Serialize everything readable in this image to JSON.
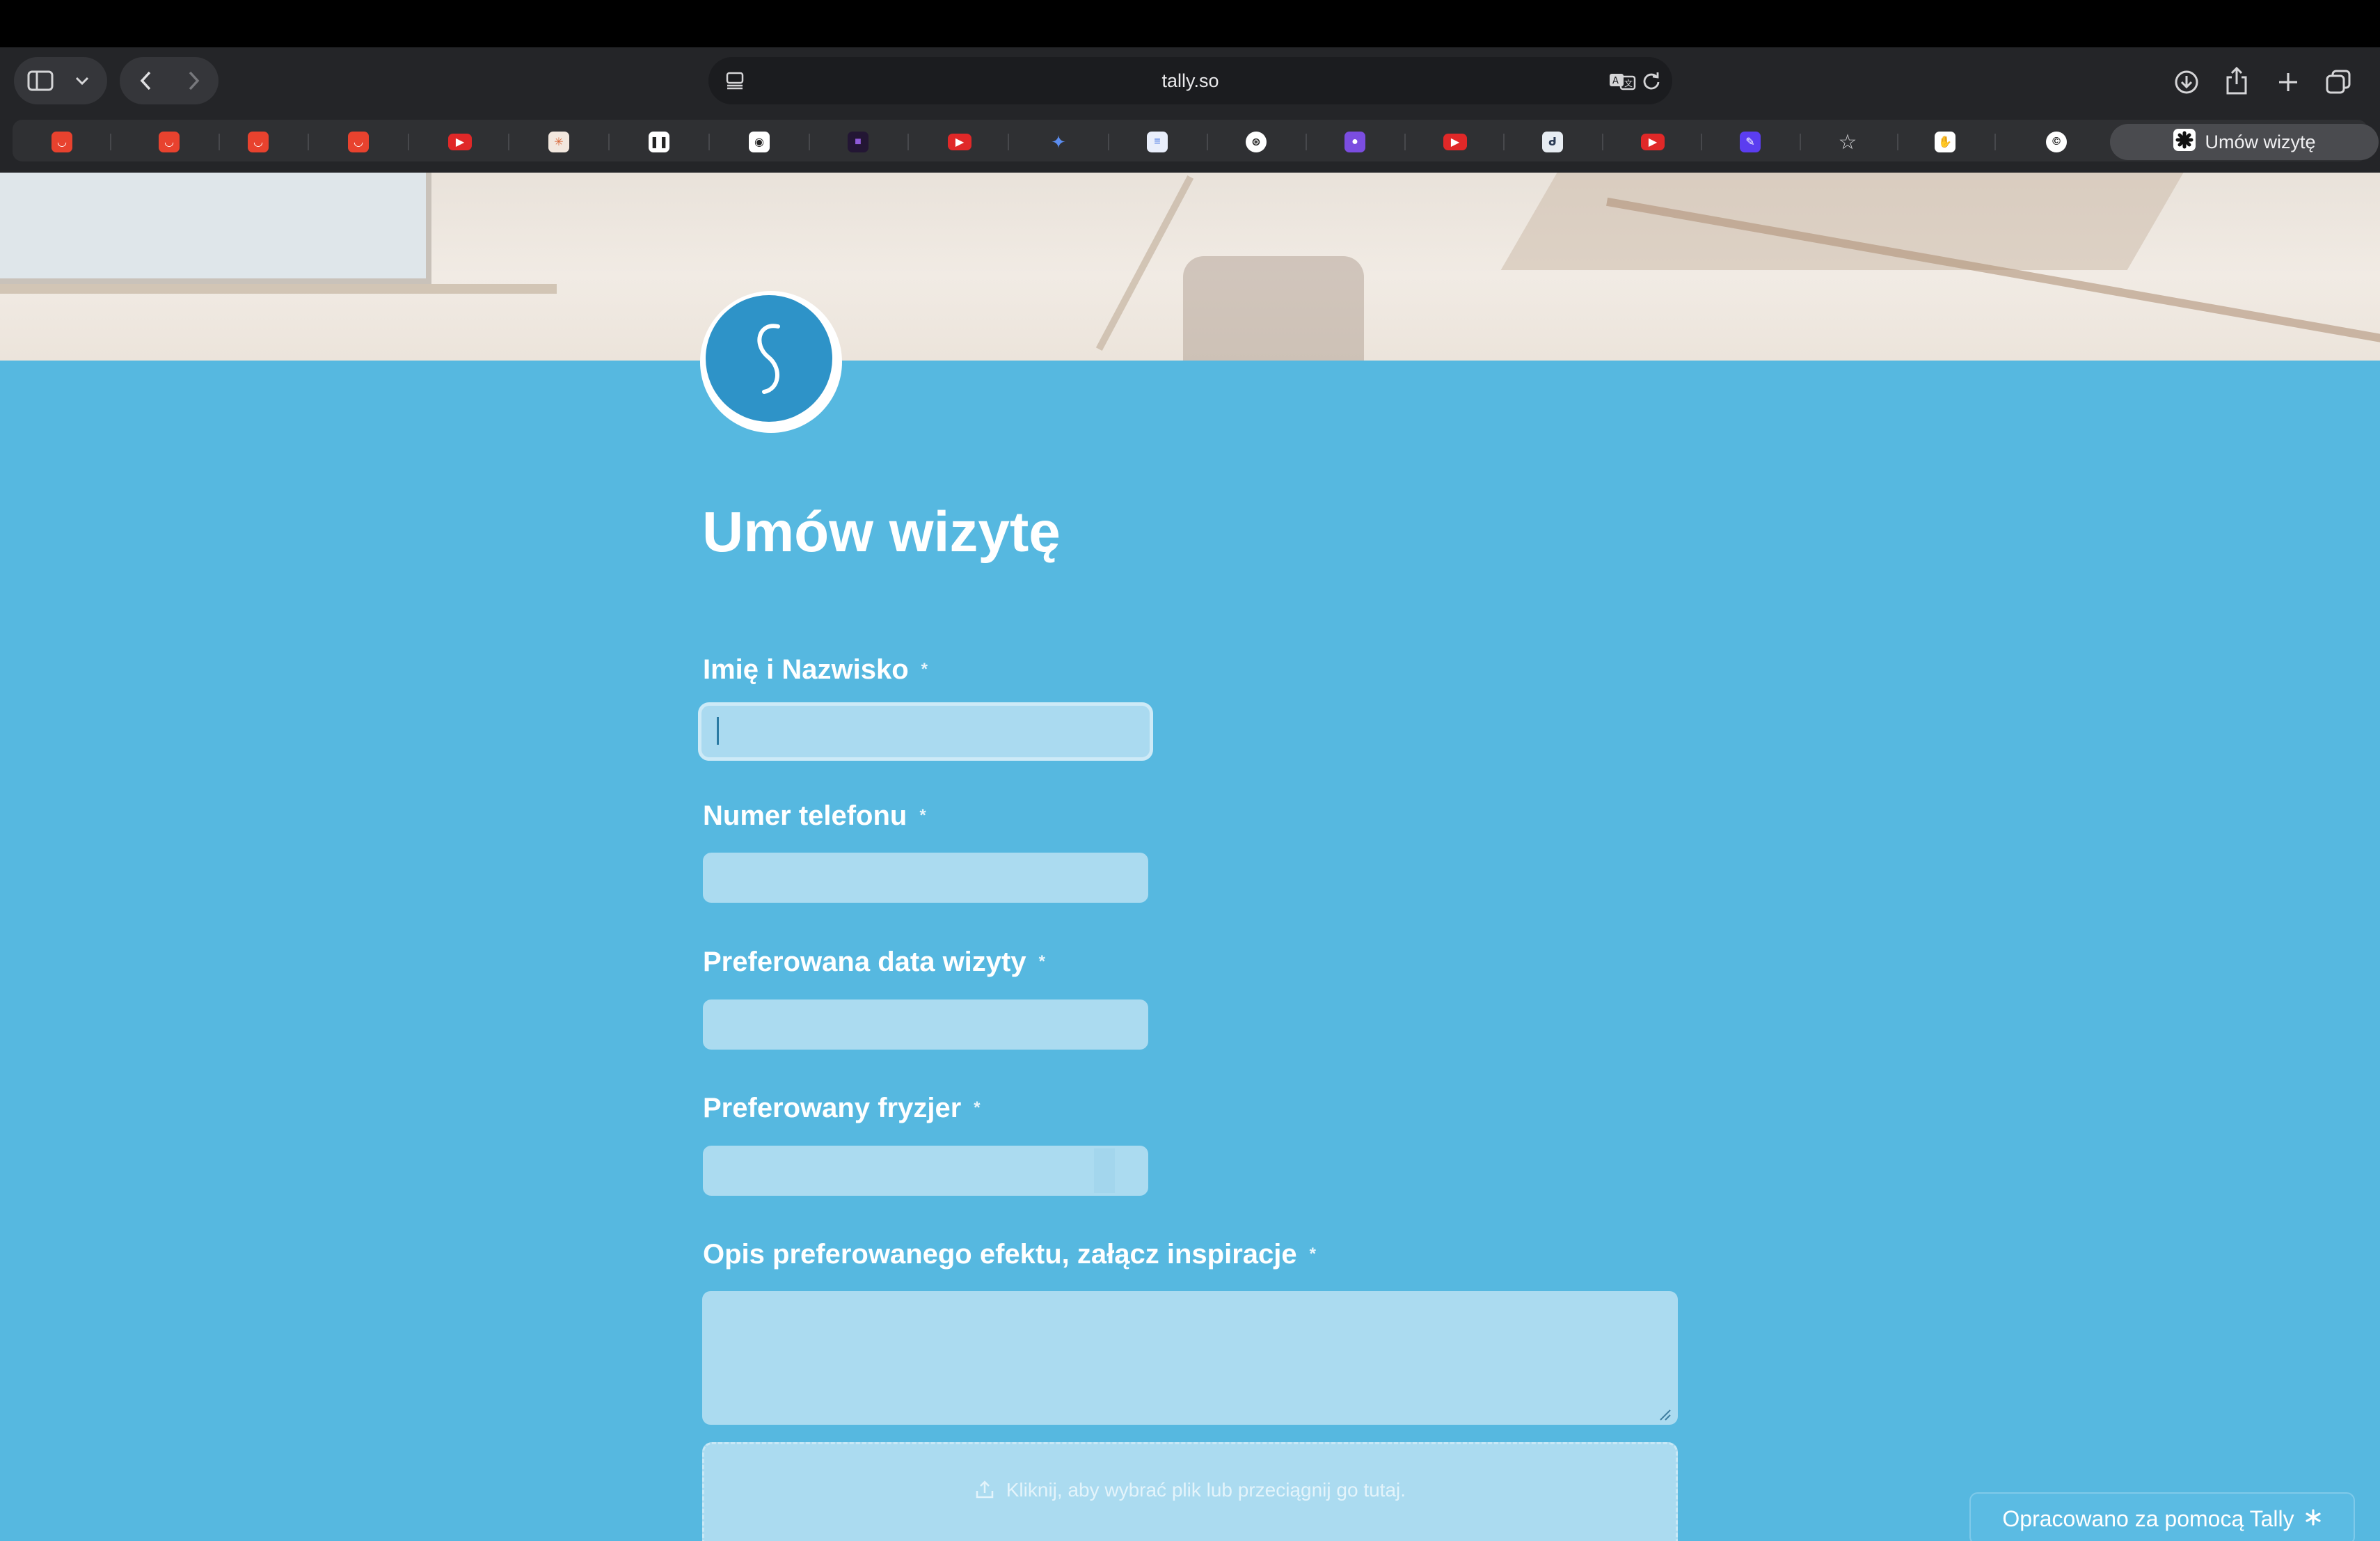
{
  "browser": {
    "url": "tally.so",
    "active_tab_title": "Umów wizytę"
  },
  "form": {
    "title": "Umów wizytę",
    "fields": [
      {
        "label": "Imię i Nazwisko",
        "required_mark": "*",
        "value": ""
      },
      {
        "label": "Numer telefonu",
        "required_mark": "*",
        "value": ""
      },
      {
        "label": "Preferowana data wizyty",
        "required_mark": "*",
        "value": ""
      },
      {
        "label": "Preferowany fryzjer",
        "required_mark": "*",
        "value": ""
      },
      {
        "label": "Opis preferowanego efektu, załącz inspiracje",
        "required_mark": "*",
        "value": ""
      }
    ],
    "upload_hint": "Kliknij, aby wybrać plik lub przeciągnij go tutaj.",
    "powered_by": "Opracowano za pomocą Tally"
  },
  "colors": {
    "page_background": "#56b8e0",
    "input_background": "#abdbf0",
    "logo_blue": "#2e93c8"
  },
  "icons": {
    "sidebar": "sidebar-icon",
    "back": "chevron-left-icon",
    "forward": "chevron-right-icon",
    "download": "download-icon",
    "share": "share-icon",
    "new_tab": "plus-icon",
    "tabs": "tabs-overview-icon",
    "upload": "upload-icon"
  }
}
